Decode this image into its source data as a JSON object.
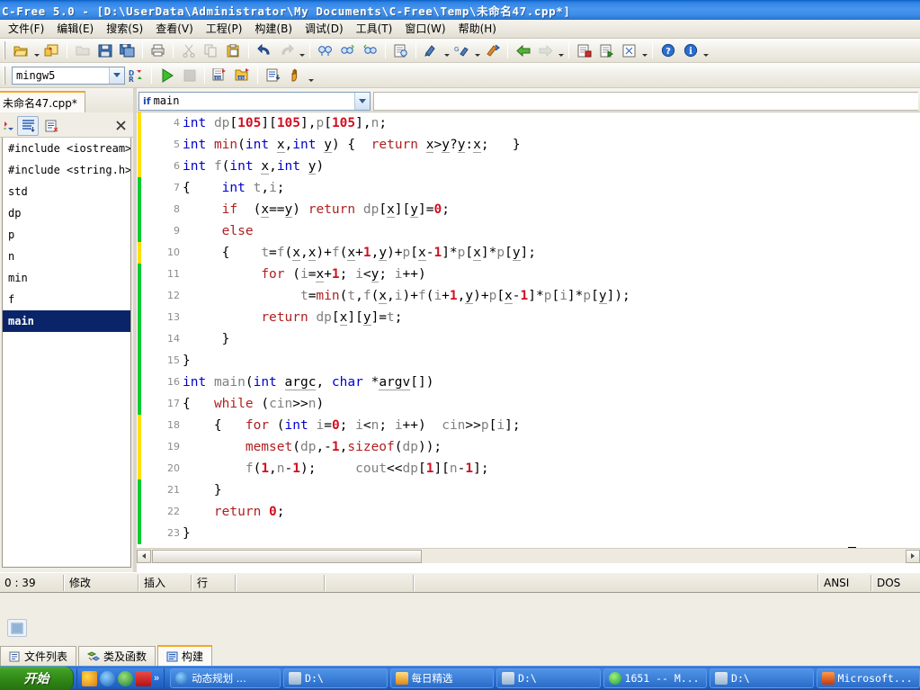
{
  "window": {
    "title": "C-Free 5.0 - [D:\\UserData\\Administrator\\My Documents\\C-Free\\Temp\\未命名47.cpp*]"
  },
  "menubar": {
    "items": [
      {
        "label": "文件(F)",
        "name": "menu-file"
      },
      {
        "label": "编辑(E)",
        "name": "menu-edit"
      },
      {
        "label": "搜索(S)",
        "name": "menu-search"
      },
      {
        "label": "查看(V)",
        "name": "menu-view"
      },
      {
        "label": "工程(P)",
        "name": "menu-project"
      },
      {
        "label": "构建(B)",
        "name": "menu-build"
      },
      {
        "label": "调试(D)",
        "name": "menu-debug"
      },
      {
        "label": "工具(T)",
        "name": "menu-tools"
      },
      {
        "label": "窗口(W)",
        "name": "menu-window"
      },
      {
        "label": "帮助(H)",
        "name": "menu-help"
      }
    ]
  },
  "toolbar2": {
    "compiler_combo_value": "mingw5"
  },
  "left_panel": {
    "file_tab_label": "未命名47.cpp*",
    "close_icon": "close-icon",
    "symbols": [
      {
        "label": "#include <iostream>",
        "selected": false
      },
      {
        "label": "#include <string.h>",
        "selected": false
      },
      {
        "label": "std",
        "selected": false
      },
      {
        "label": "dp",
        "selected": false
      },
      {
        "label": "p",
        "selected": false
      },
      {
        "label": "n",
        "selected": false
      },
      {
        "label": "min",
        "selected": false
      },
      {
        "label": "f",
        "selected": false
      },
      {
        "label": "main",
        "selected": true
      }
    ]
  },
  "editor": {
    "function_combo_value": "main",
    "function_combo_icon": "if",
    "first_visible_line": 4,
    "lines": [
      {
        "n": 4,
        "change": "yellow"
      },
      {
        "n": 5,
        "change": "yellow"
      },
      {
        "n": 6,
        "change": "yellow"
      },
      {
        "n": 7,
        "change": "green"
      },
      {
        "n": 8,
        "change": "green"
      },
      {
        "n": 9,
        "change": "green"
      },
      {
        "n": 10,
        "change": "yellow"
      },
      {
        "n": 11,
        "change": "green"
      },
      {
        "n": 12,
        "change": "green"
      },
      {
        "n": 13,
        "change": "green"
      },
      {
        "n": 14,
        "change": "green"
      },
      {
        "n": 15,
        "change": "green"
      },
      {
        "n": 16,
        "change": "green"
      },
      {
        "n": 17,
        "change": "green"
      },
      {
        "n": 18,
        "change": "yellow"
      },
      {
        "n": 19,
        "change": "yellow"
      },
      {
        "n": 20,
        "change": "yellow"
      },
      {
        "n": 21,
        "change": "green"
      },
      {
        "n": 22,
        "change": "green"
      },
      {
        "n": 23,
        "change": "green"
      }
    ],
    "code_text": [
      "int dp[105][105],p[105],n;",
      "int min(int x,int y) {  return x>y?y:x;   }",
      "int f(int x,int y)",
      "{    int t,i;",
      "     if  (x==y) return dp[x][y]=0;",
      "     else",
      "     {    t=f(x,x)+f(x+1,y)+p[x-1]*p[x]*p[y];",
      "          for (i=x+1; i<y; i++)",
      "               t=min(t,f(x,i)+f(i+1,y)+p[x-1]*p[i]*p[y]);",
      "          return dp[x][y]=t;",
      "     }",
      "}",
      "int main(int argc, char *argv[])",
      "{   while (cin>>n)",
      "    {   for (int i=0; i<n; i++)  cin>>p[i];",
      "        memset(dp,-1,sizeof(dp));",
      "        f(1,n-1);     cout<<dp[1][n-1];",
      "    }",
      "    return 0;",
      "}"
    ]
  },
  "statusbar": {
    "position": "0 : 39",
    "modified": "修改",
    "insert_mode": "插入",
    "row_label": "行",
    "encoding": "ANSI",
    "line_ending": "DOS"
  },
  "bottom_panel": {
    "tabs": [
      {
        "label": "文件列表",
        "icon": "file-list-icon",
        "active": false
      },
      {
        "label": "类及函数",
        "icon": "class-func-icon",
        "active": false
      },
      {
        "label": "构建",
        "icon": "build-icon",
        "active": true
      }
    ]
  },
  "taskbar": {
    "start_label": "开始",
    "quick_launch": [
      "media-icon",
      "internet-explorer-icon",
      "browser-icon",
      "red-app-icon",
      "chevron-double-right-icon"
    ],
    "tasks": [
      {
        "label": "动态规划 ...",
        "icon": "browser-icon"
      },
      {
        "label": "D:\\",
        "icon": "folder-icon"
      },
      {
        "label": "每日精选",
        "icon": "cart-icon"
      },
      {
        "label": "D:\\",
        "icon": "folder-icon"
      },
      {
        "label": "1651 -- M...",
        "icon": "qq-icon"
      },
      {
        "label": "D:\\",
        "icon": "folder-icon"
      },
      {
        "label": "Microsoft...",
        "icon": "office-icon"
      }
    ]
  },
  "colors": {
    "title_blue": "#2f82e4",
    "accent_orange": "#f5a623",
    "selection_blue": "#0a246a",
    "change_green": "#00cc33",
    "change_yellow": "#ffe000",
    "keyword_blue": "#0000d0",
    "control_red": "#b02020",
    "number_red": "#d01020"
  }
}
